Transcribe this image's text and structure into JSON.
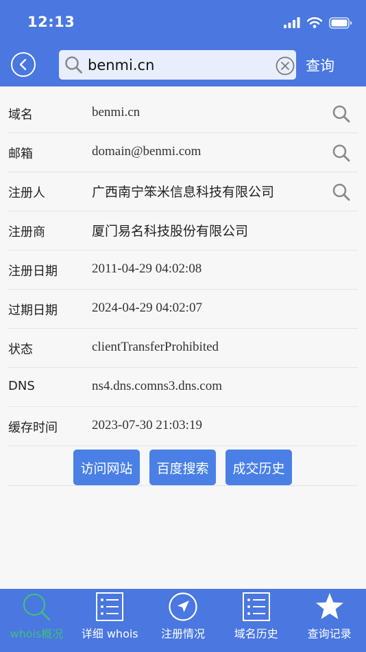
{
  "status_bar": {
    "time": "12:13"
  },
  "search": {
    "value": "benmi.cn",
    "query_label": "查询"
  },
  "rows": [
    {
      "label": "域名",
      "value": "benmi.cn",
      "searchable": true
    },
    {
      "label": "邮箱",
      "value": "domain@benmi.com",
      "searchable": true
    },
    {
      "label": "注册人",
      "value": "广西南宁笨米信息科技有限公司",
      "searchable": true
    },
    {
      "label": "注册商",
      "value": "厦门易名科技股份有限公司",
      "searchable": false
    },
    {
      "label": "注册日期",
      "value": "2011-04-29 04:02:08",
      "searchable": false
    },
    {
      "label": "过期日期",
      "value": "2024-04-29 04:02:07",
      "searchable": false
    },
    {
      "label": "状态",
      "value": "clientTransferProhibited",
      "searchable": false
    },
    {
      "label": "DNS",
      "value": "ns4.dns.comns3.dns.com",
      "searchable": false
    },
    {
      "label": "缓存时间",
      "value": "2023-07-30 21:03:19",
      "searchable": false
    }
  ],
  "actions": {
    "visit": "访问网站",
    "baidu": "百度搜索",
    "history": "成交历史"
  },
  "tabs": [
    {
      "label": "whois概况",
      "icon": "search-icon",
      "active": true
    },
    {
      "label": "详细 whois",
      "icon": "list-icon",
      "active": false
    },
    {
      "label": "注册情况",
      "icon": "navigation-icon",
      "active": false
    },
    {
      "label": "域名历史",
      "icon": "list-icon",
      "active": false
    },
    {
      "label": "查询记录",
      "icon": "star-icon",
      "active": false
    }
  ],
  "colors": {
    "header": "#4a77e0",
    "button": "#4a80e6",
    "active_tab": "#3fbf7f"
  }
}
